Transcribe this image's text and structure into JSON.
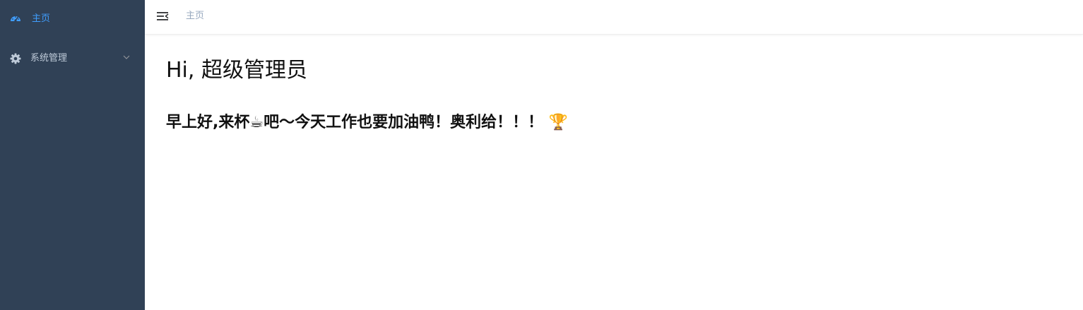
{
  "sidebar": {
    "items": [
      {
        "label": "主页",
        "icon": "dashboard-icon",
        "active": true
      },
      {
        "label": "系统管理",
        "icon": "gear-icon",
        "expandable": true
      }
    ],
    "background": "#304156",
    "active_color": "#409eff",
    "text_color": "#bfcbd9"
  },
  "header": {
    "breadcrumb": "主页"
  },
  "main": {
    "greeting": "Hi, 超级管理员",
    "message": "早上好,来杯☕吧～今天工作也要加油鸭！奥利给！！！ 🏆"
  }
}
